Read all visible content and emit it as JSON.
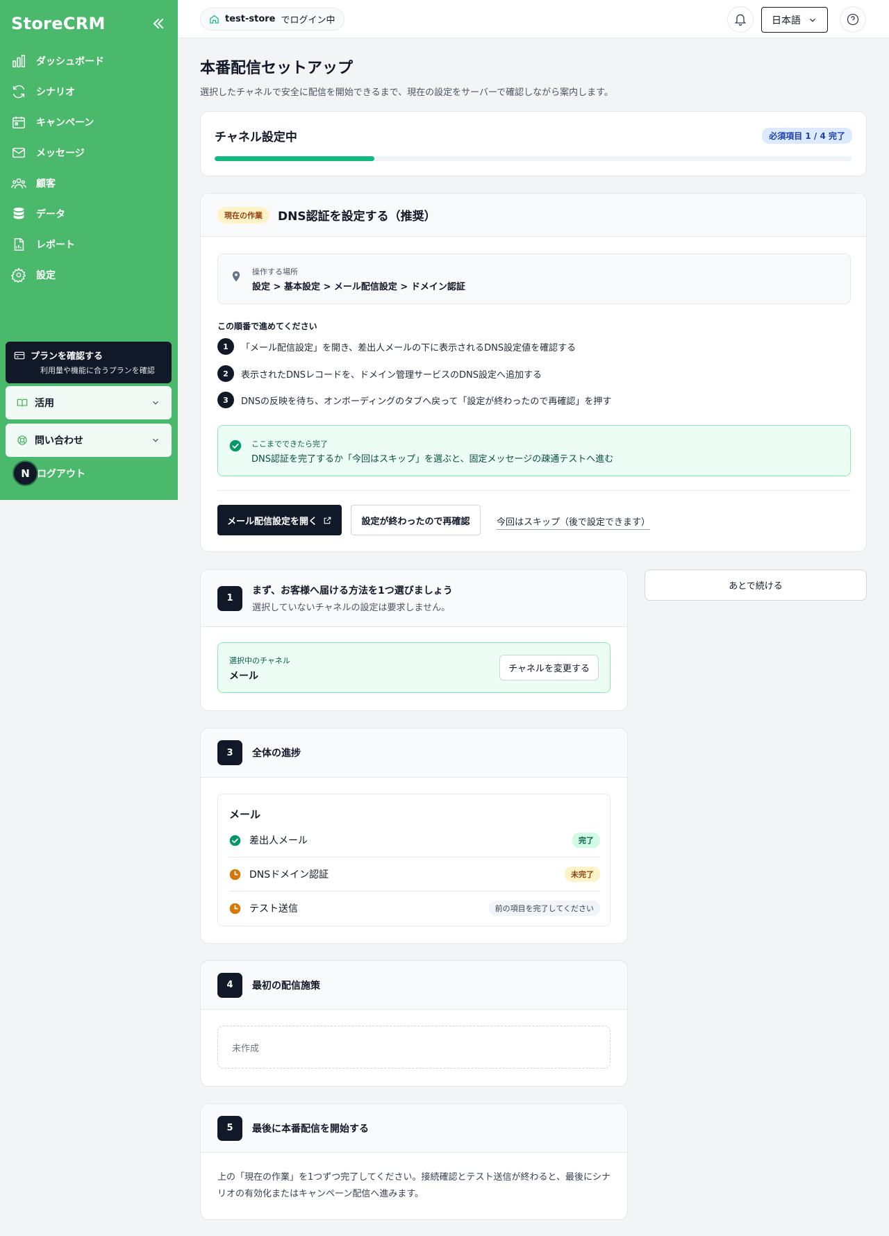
{
  "sidebar": {
    "logo": "StoreCRM",
    "items": [
      {
        "label": "ダッシュボード",
        "icon": "bar-chart-icon"
      },
      {
        "label": "シナリオ",
        "icon": "refresh-icon"
      },
      {
        "label": "キャンペーン",
        "icon": "calendar-icon"
      },
      {
        "label": "メッセージ",
        "icon": "mail-icon"
      },
      {
        "label": "顧客",
        "icon": "users-icon"
      },
      {
        "label": "データ",
        "icon": "database-icon"
      },
      {
        "label": "レポート",
        "icon": "report-icon"
      },
      {
        "label": "設定",
        "icon": "gear-icon"
      }
    ],
    "plan_title": "プランを確認する",
    "plan_sub": "利用量や機能に合うプランを確認",
    "accordion_usage": "活用",
    "accordion_contact": "問い合わせ",
    "avatar_letter": "N",
    "logout": "ログアウト"
  },
  "topbar": {
    "store_name": "test-store",
    "store_suffix": "でログイン中",
    "language": "日本語"
  },
  "page": {
    "title": "本番配信セットアップ",
    "description": "選択したチャネルで安全に配信を開始できるまで、現在の設定をサーバーで確認しながら案内します。"
  },
  "progress": {
    "title": "チャネル設定中",
    "badge": "必須項目 1 / 4 完了",
    "fraction": 0.25
  },
  "task": {
    "badge": "現在の作業",
    "title": "DNS認証を設定する（推奨）",
    "location_label": "操作する場所",
    "location_path": "設定 > 基本設定 > メール配信設定 > ドメイン認証",
    "steps_label": "この順番で進めてください",
    "steps": [
      {
        "num": "1",
        "text": "「メール配信設定」を開き、差出人メールの下に表示されるDNS設定値を確認する"
      },
      {
        "num": "2",
        "text": "表示されたDNSレコードを、ドメイン管理サービスのDNS設定へ追加する"
      },
      {
        "num": "3",
        "text": "DNSの反映を待ち、オンボーディングのタブへ戻って「設定が終わったので再確認」を押す"
      }
    ],
    "done_label": "ここまでできたら完了",
    "done_text": "DNS認証を完了するか「今回はスキップ」を選ぶと、固定メッセージの疎通テストへ進む",
    "btn_open": "メール配信設定を開く",
    "btn_recheck": "設定が終わったので再確認",
    "link_skip": "今回はスキップ（後で設定できます）"
  },
  "later_button": "あとで続ける",
  "section1": {
    "num": "1",
    "title": "まず、お客様へ届ける方法を1つ選びましょう",
    "sub": "選択していないチャネルの設定は要求しません。",
    "channel_label": "選択中のチャネル",
    "channel_value": "メール",
    "change_button": "チャネルを変更する"
  },
  "section3": {
    "num": "3",
    "title": "全体の進捗",
    "group": "メール",
    "rows": [
      {
        "label": "差出人メール",
        "status": "完了"
      },
      {
        "label": "DNSドメイン認証",
        "status": "未完了"
      },
      {
        "label": "テスト送信",
        "status": "前の項目を完了してください"
      }
    ]
  },
  "section4": {
    "num": "4",
    "title": "最初の配信施策",
    "empty": "未作成"
  },
  "section5": {
    "num": "5",
    "title": "最後に本番配信を開始する",
    "text": "上の「現在の作業」を1つずつ完了してください。接続確認とテスト送信が終わると、最後にシナリオの有効化またはキャンペーン配信へ進みます。"
  },
  "colors": {
    "sidebar": "#4bb96b",
    "dark": "#111827",
    "success": "#10b981",
    "warning": "#d97706"
  }
}
